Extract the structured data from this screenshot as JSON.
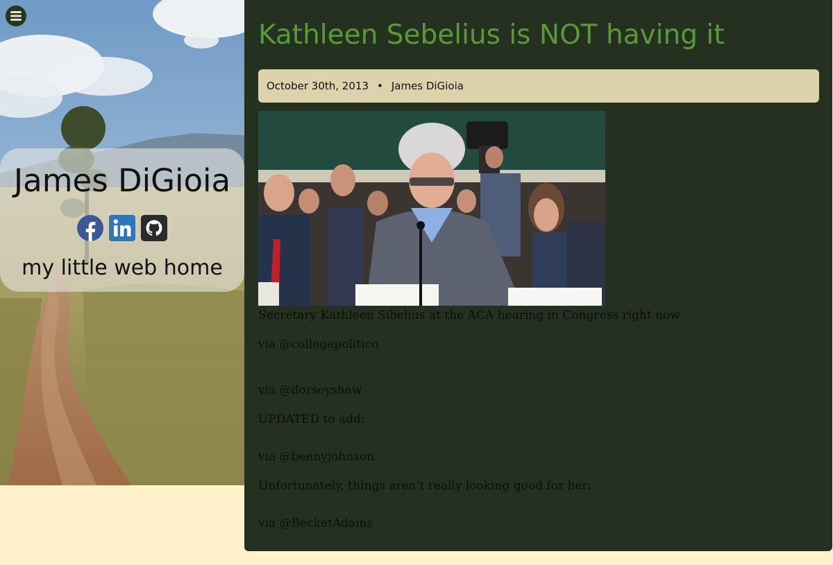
{
  "site": {
    "name": "James DiGioia",
    "tagline": "my little web home",
    "menu_icon": "hamburger-menu-icon",
    "social": [
      {
        "icon": "facebook-icon",
        "color": "#3b5998"
      },
      {
        "icon": "linkedin-icon",
        "color": "#2f75bb"
      },
      {
        "icon": "github-icon",
        "color": "#2b2b2b"
      }
    ]
  },
  "post": {
    "title": "Kathleen Sebelius is NOT having it",
    "date": "October 30th, 2013",
    "separator": "•",
    "author": "James DiGioia",
    "paragraphs": {
      "caption": "Secretary Kathleen Sibelius at the ACA hearing in Congress right now",
      "via1": "via @collegepolitico",
      "via2": "via @dorseyshaw",
      "updated": "UPDATED to add:",
      "via3": "via @bennyjohnson",
      "unfortunately": "Unfortunately, things aren't really looking good for her:",
      "via4": "via @BecketAdams"
    }
  },
  "colors": {
    "page_background": "#fff2c9",
    "article_background": "#243120",
    "title": "#5a9a36",
    "meta_bar": "#dcd3ad",
    "menu_button": "#263520"
  }
}
